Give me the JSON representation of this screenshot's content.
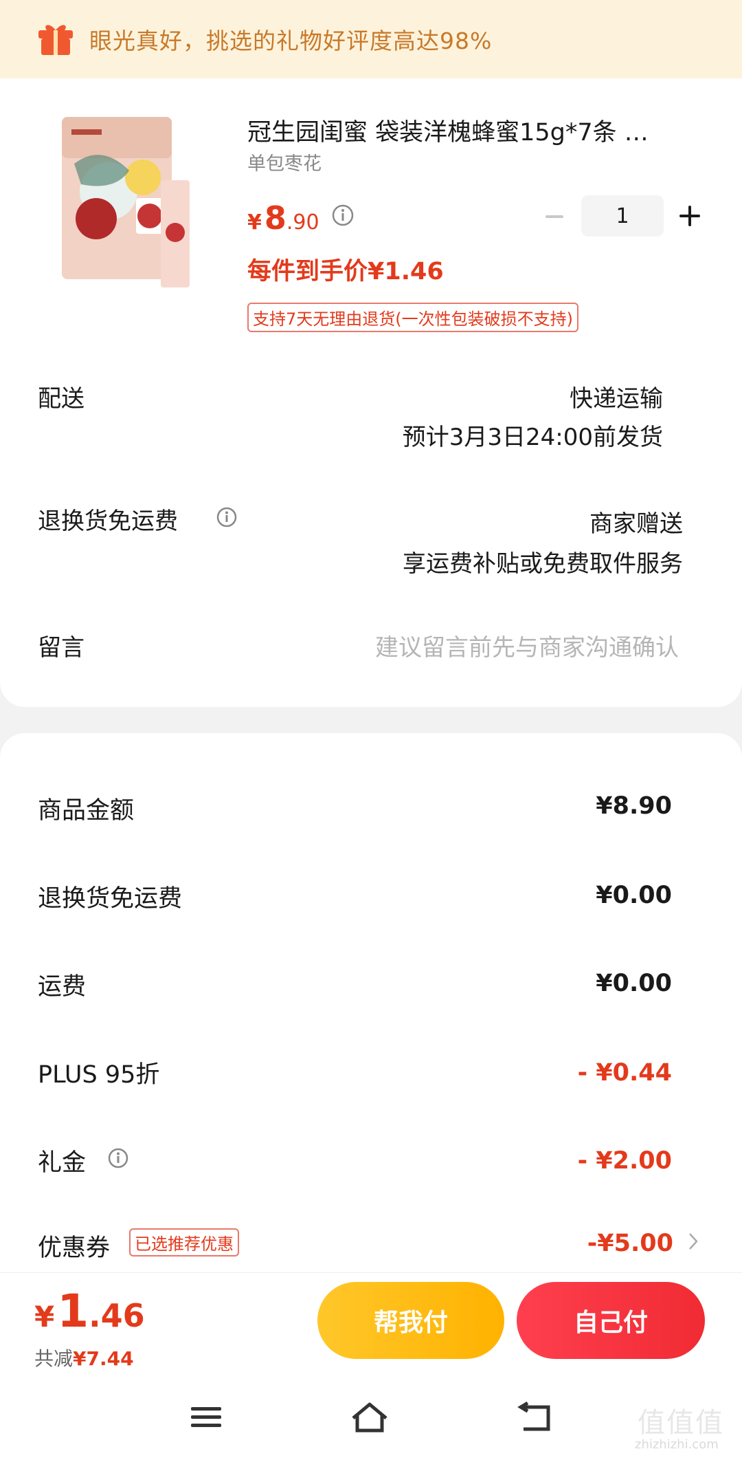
{
  "banner": {
    "text": "眼光真好，挑选的礼物好评度高达98%",
    "icon": "gift-icon"
  },
  "product": {
    "title": "冠生园闺蜜 袋装洋槐蜂蜜15g*7条 …",
    "spec": "单包枣花",
    "price_currency": "¥",
    "price_int": "8",
    "price_dec": ".90",
    "quantity": "1",
    "unit_price": "每件到手价¥1.46",
    "return_policy": "支持7天无理由退货(一次性包装破损不支持)"
  },
  "delivery": {
    "label": "配送",
    "method": "快递运输",
    "eta": "预计3月3日24:00前发货"
  },
  "return_shipping": {
    "label": "退换货免运费",
    "value": "商家赠送",
    "detail": "享运费补贴或免费取件服务"
  },
  "message": {
    "label": "留言",
    "placeholder": "建议留言前先与商家沟通确认"
  },
  "summary": [
    {
      "label": "商品金额",
      "value": "¥8.90",
      "red": false
    },
    {
      "label": "退换货免运费",
      "value": "¥0.00",
      "red": false
    },
    {
      "label": "运费",
      "value": "¥0.00",
      "red": false
    },
    {
      "label": "PLUS 95折",
      "value": "- ¥0.44",
      "red": true
    },
    {
      "label": "礼金",
      "value": "- ¥2.00",
      "red": true
    },
    {
      "label": "优惠券",
      "value": "-¥5.00",
      "red": true
    }
  ],
  "coupon_tag": "已选推荐优惠",
  "footer": {
    "total_currency": "¥",
    "total_int": "1",
    "total_dec": ".46",
    "saved_label": "共减",
    "saved_value": "¥7.44",
    "help_pay": "帮我付",
    "self_pay": "自己付"
  },
  "watermark": {
    "text": "值值值",
    "url": "zhizhizhi.com"
  },
  "colors": {
    "accent_red": "#e33a1c",
    "banner_bg": "#fdf3dc",
    "help_pay": "#ffbb14",
    "self_pay": "#f2303c"
  }
}
